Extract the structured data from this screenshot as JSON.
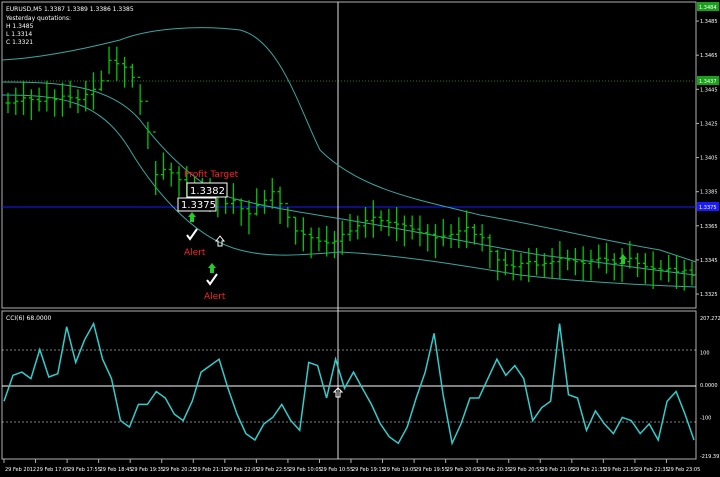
{
  "header": {
    "symbol_line": "EURUSD,M5  1.3387 1.3389 1.3386 1.3385",
    "yesterday_title": "Yesterday quotations:",
    "yesterday_high": "H  1.3485",
    "yesterday_low": "L  1.3314",
    "yesterday_close": "C  1.3321"
  },
  "price_axis": {
    "ticks": [
      "1.3485",
      "1.3465",
      "1.3445",
      "1.3425",
      "1.3405",
      "1.3385",
      "1.3365",
      "1.3345",
      "1.3325"
    ],
    "current_price_label": "1.3375",
    "top_label": "1.3484",
    "green_level_label": "1.3437"
  },
  "annotations": {
    "profit_target": "Profit Target",
    "price_box_1": "1.3382",
    "price_box_2": "1.3375",
    "alert_1": "Alert",
    "alert_2": "Alert"
  },
  "indicator": {
    "title": "CCI(6) 68.0000",
    "ticks": [
      "207.2722",
      "100",
      "0.0000",
      "-100",
      "-219.3913"
    ]
  },
  "time_axis": {
    "labels": [
      "29 Feb 2012",
      "29 Feb 17:05",
      "29 Feb 17:55",
      "29 Feb 18:45",
      "29 Feb 19:35",
      "29 Feb 20:25",
      "29 Feb 21:15",
      "29 Feb 22:05",
      "29 Feb 22:55",
      "29 Feb 10:05",
      "29 Feb 10:55",
      "29 Feb 19:15",
      "29 Feb 19:05",
      "29 Feb 19:55",
      "29 Feb 20:05",
      "29 Feb 20:35",
      "29 Feb 20:55",
      "29 Feb 21:05",
      "29 Feb 21:35",
      "29 Feb 21:55",
      "29 Feb 22:35",
      "29 Feb 23:05"
    ]
  },
  "colors": {
    "background": "#000000",
    "candles": "#00c800",
    "bands": "#3aa6a0",
    "current_price_line": "#1a1aff",
    "cci_line": "#33cccc",
    "alert_text": "#ff2222",
    "frame": "#b0b0b0"
  },
  "chart_data": {
    "type": "line",
    "title": "",
    "price_ylim": [
      1.3318,
      1.3495
    ],
    "ohlc_close": [
      1.3437,
      1.3438,
      1.344,
      1.3439,
      1.3438,
      1.344,
      1.3439,
      1.3441,
      1.344,
      1.3439,
      1.3442,
      1.3445,
      1.345,
      1.3462,
      1.346,
      1.3458,
      1.3452,
      1.3438,
      1.342,
      1.3395,
      1.3398,
      1.3396,
      1.3392,
      1.339,
      1.3388,
      1.3385,
      1.3383,
      1.3382,
      1.3378,
      1.338,
      1.3375,
      1.3372,
      1.3377,
      1.338,
      1.3385,
      1.3378,
      1.337,
      1.3362,
      1.336,
      1.3358,
      1.3356,
      1.3355,
      1.3356,
      1.336,
      1.3362,
      1.3365,
      1.3368,
      1.337,
      1.3368,
      1.3367,
      1.3366,
      1.3365,
      1.3363,
      1.3361,
      1.336,
      1.3358,
      1.3359,
      1.336,
      1.3362,
      1.3364,
      1.336,
      1.3358,
      1.335,
      1.3345,
      1.3342,
      1.3341,
      1.3343,
      1.3344,
      1.3342,
      1.3343,
      1.3344,
      1.3346,
      1.3345,
      1.3344,
      1.3343,
      1.3345,
      1.3346,
      1.3345,
      1.3343,
      1.3344,
      1.3346,
      1.3343,
      1.3341,
      1.334,
      1.3339,
      1.334,
      1.3338,
      1.3339,
      1.3336
    ],
    "cci_ylim": [
      -219.3913,
      207.2722
    ],
    "cci_values": [
      -50,
      30,
      40,
      20,
      110,
      25,
      35,
      180,
      70,
      140,
      190,
      80,
      20,
      -110,
      -130,
      -60,
      -60,
      -20,
      -40,
      -90,
      -110,
      -50,
      40,
      60,
      80,
      -10,
      -90,
      -150,
      -170,
      -120,
      -100,
      -60,
      -110,
      -140,
      70,
      60,
      -40,
      80,
      -10,
      40,
      -10,
      -60,
      -120,
      -160,
      -180,
      -130,
      -40,
      40,
      160,
      -30,
      -180,
      -120,
      -40,
      -40,
      20,
      80,
      30,
      60,
      20,
      -110,
      -70,
      -50,
      190,
      -30,
      -40,
      -140,
      -80,
      -120,
      -150,
      -100,
      -110,
      -150,
      -120,
      -170,
      -50,
      -20,
      -90,
      -170
    ]
  }
}
